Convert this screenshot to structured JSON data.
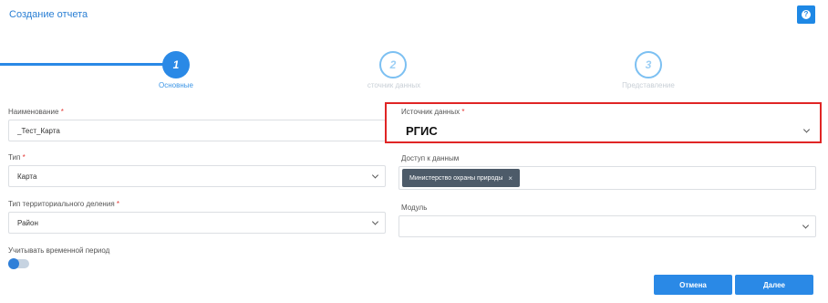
{
  "header": {
    "title": "Создание отчета",
    "help_icon": "question-mark-icon"
  },
  "stepper": {
    "steps": [
      {
        "number": "1",
        "label": "Основные"
      },
      {
        "number": "2",
        "label": "сточник данных"
      },
      {
        "number": "3",
        "label": "Представление"
      }
    ]
  },
  "form": {
    "name": {
      "label": "Наименование",
      "required": "*",
      "value": "_Тест_Карта"
    },
    "type": {
      "label": "Тип",
      "required": "*",
      "value": "Карта"
    },
    "territorial": {
      "label": "Тип территориального деления",
      "required": "*",
      "value": "Район"
    },
    "time_period": {
      "label": "Учитывать временной период"
    },
    "source": {
      "label": "Источник данных",
      "required": "*",
      "value": "РГИС"
    },
    "access": {
      "label": "Доступ к данным",
      "tag": "Министерство охраны природы",
      "tag_remove": "×"
    },
    "module": {
      "label": "Модуль",
      "value": ""
    }
  },
  "buttons": {
    "cancel": "Отмена",
    "next": "Далее"
  },
  "colors": {
    "accent": "#2a89e6",
    "highlight": "#e02525",
    "tag_bg": "#4d5b69"
  }
}
